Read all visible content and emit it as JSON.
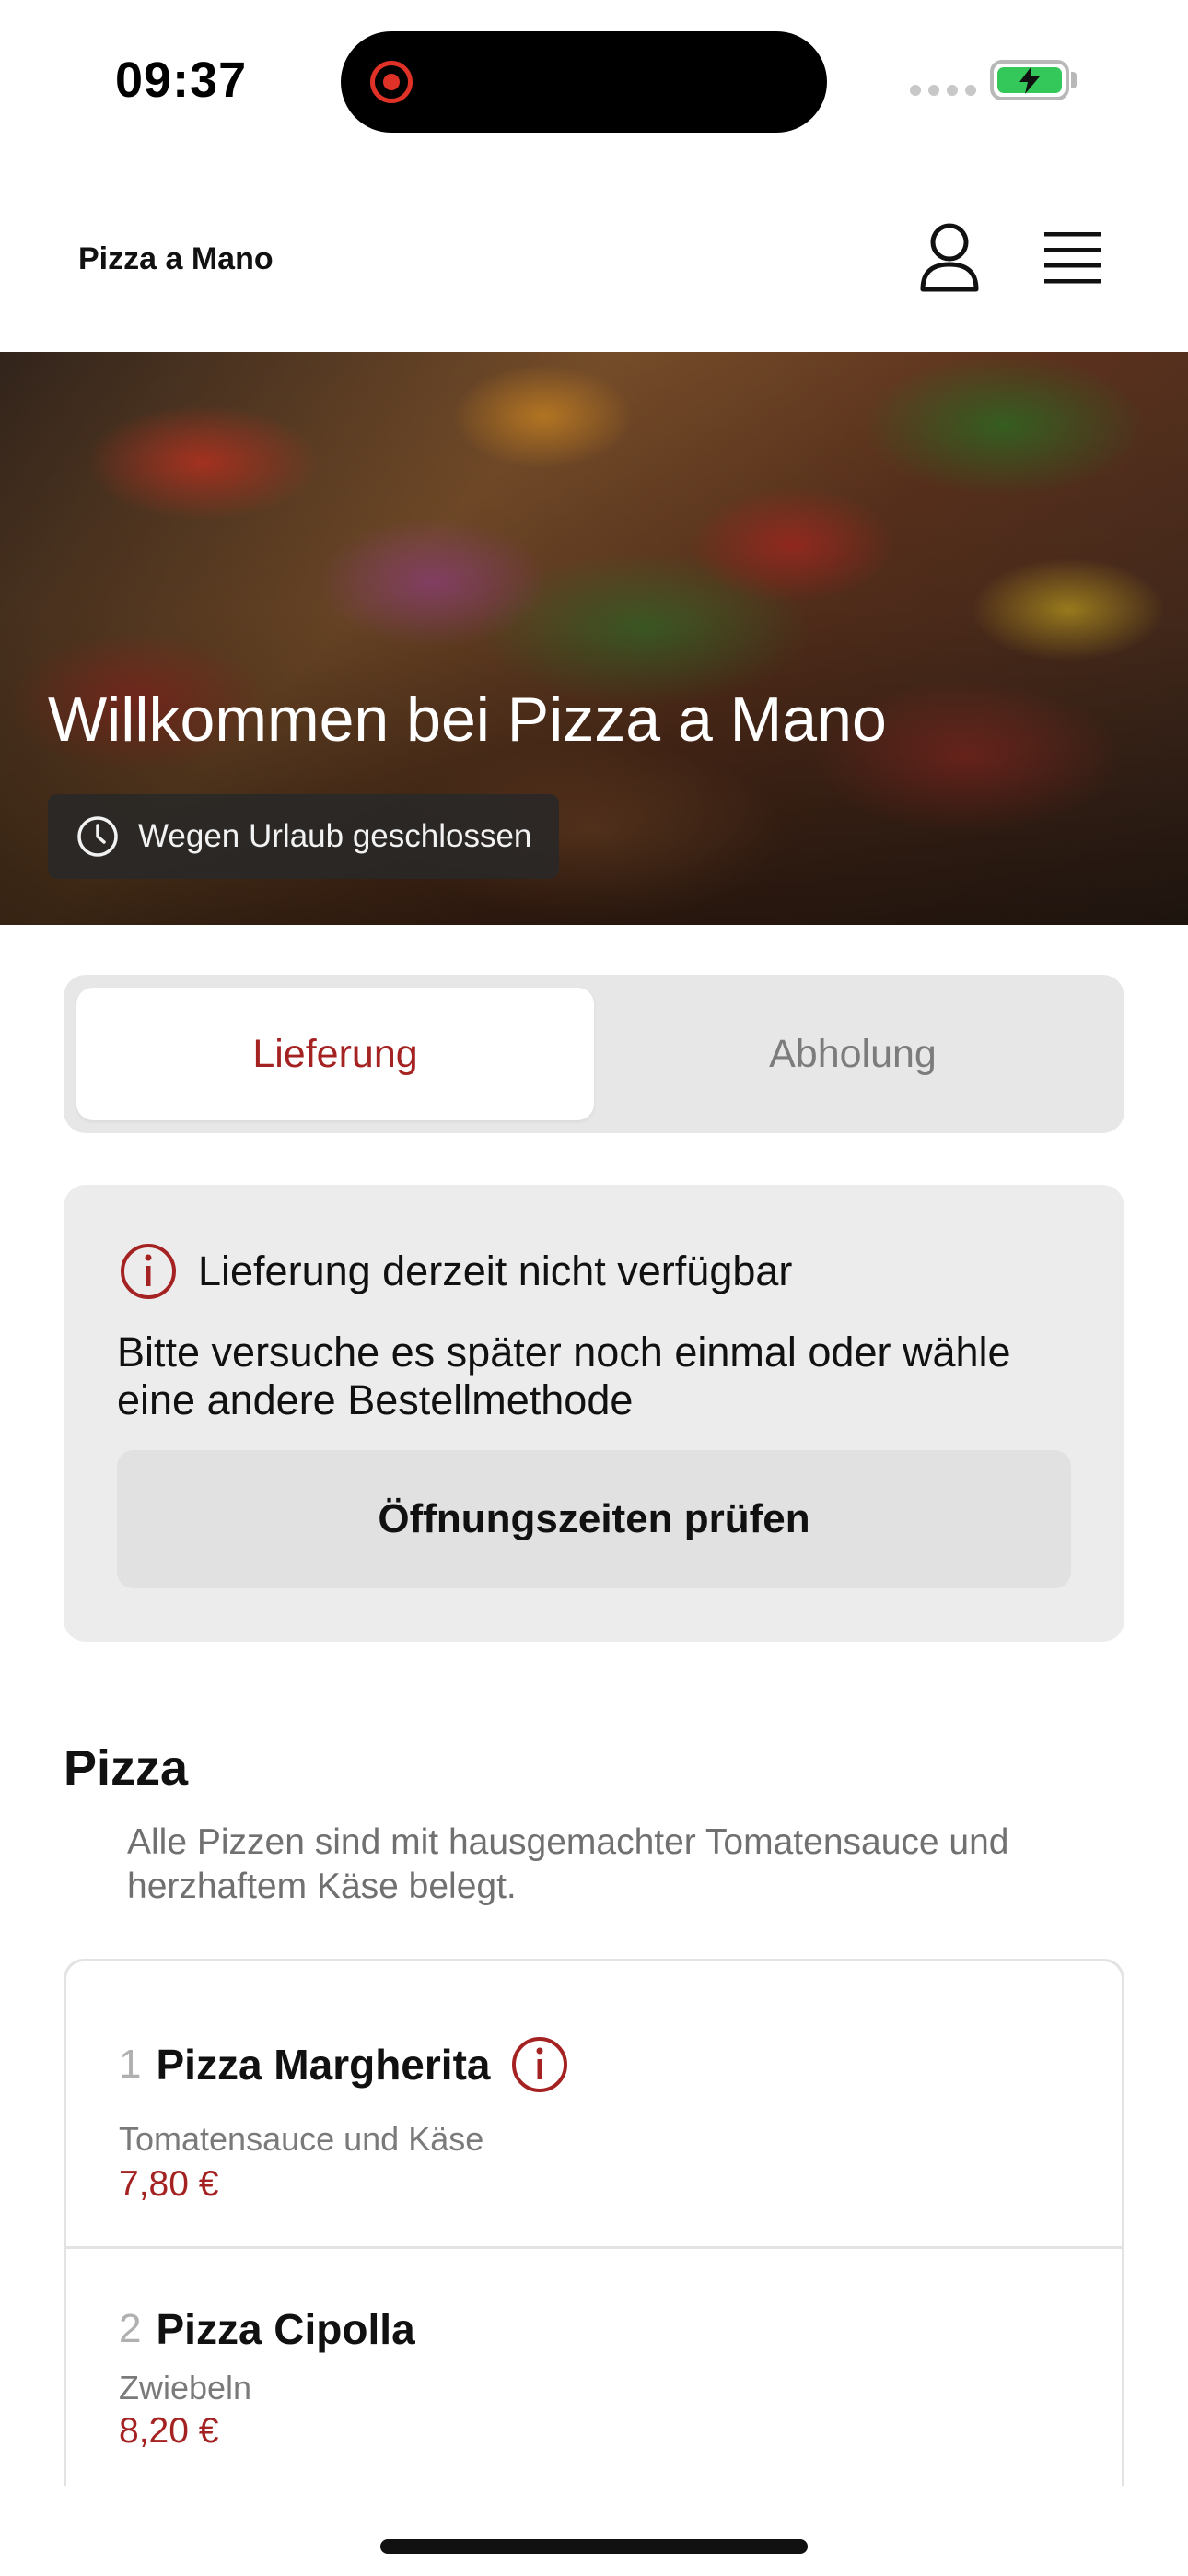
{
  "status_bar": {
    "time": "09:37"
  },
  "header": {
    "brand": "Pizza a Mano",
    "profile_icon": "user-icon",
    "menu_icon": "hamburger-menu-icon"
  },
  "hero": {
    "title": "Willkommen bei Pizza a Mano",
    "status_text": "Wegen Urlaub geschlossen",
    "status_icon": "clock-icon"
  },
  "order_mode": {
    "options": [
      "Lieferung",
      "Abholung"
    ],
    "selected": "Lieferung"
  },
  "notice": {
    "icon": "info-icon",
    "title": "Lieferung derzeit nicht verfügbar",
    "text": "Bitte versuche es später noch einmal oder wähle eine andere Bestellmethode",
    "button_label": "Öffnungszeiten prüfen"
  },
  "category": {
    "title": "Pizza",
    "description": "Alle Pizzen sind mit hausgemachter Tomatensauce und herzhaftem Käse belegt."
  },
  "products": [
    {
      "number": "1",
      "name": "Pizza Margherita",
      "description": "Tomatensauce und Käse",
      "price": "7,80 €",
      "has_info": true
    },
    {
      "number": "2",
      "name": "Pizza Cipolla",
      "description": "Zwiebeln",
      "price": "8,20 €",
      "has_info": false
    }
  ],
  "colors": {
    "accent": "#a52222",
    "battery": "#34c759",
    "recording": "#e03127"
  }
}
